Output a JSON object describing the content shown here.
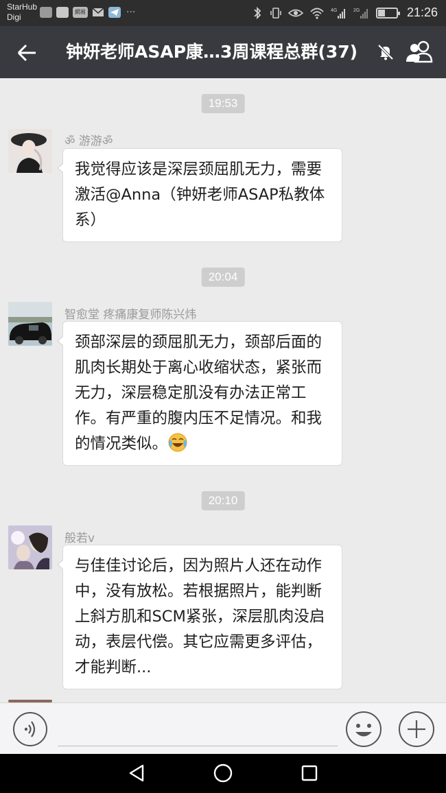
{
  "status_bar": {
    "carrier_line1": "StarHub",
    "carrier_line2": "Digi",
    "time": "21:26",
    "network_label": "網易",
    "signal_1_label": "4G",
    "signal_2_label": "2G",
    "battery_level": 0.4
  },
  "header": {
    "title": "钟妍老师ASAP康…3周课程总群(37)",
    "back_icon": "arrow-left-icon",
    "mute_icon": "bell-off-icon",
    "members_icon": "group-icon"
  },
  "chat": {
    "messages": [
      {
        "time": "19:53",
        "sender": "ॐ 游游ॐ",
        "text": "我觉得应该是深层颈屈肌无力，需要激活@Anna（钟妍老师ASAP私教体系）"
      },
      {
        "time": "20:04",
        "sender": "智愈堂 疼痛康复师陈兴炜",
        "text": "颈部深层的颈屈肌无力，颈部后面的肌肉长期处于离心收缩状态，紧张而无力，深层稳定肌没有办法正常工作。有严重的腹内压不足情况。和我的情况类似。",
        "emoji": "crying-laughing-emoji"
      },
      {
        "time": "20:10",
        "sender": "般若v",
        "text": "与佳佳讨论后，因为照片人还在动作中，没有放松。若根据照片，能判断上斜方肌和SCM紧张，深层肌肉没启动，表层代偿。其它应需更多评估，才能判断..."
      }
    ]
  },
  "input_bar": {
    "voice_icon": "voice-icon",
    "emoji_icon": "smiley-icon",
    "plus_icon": "plus-icon"
  },
  "nav_bar": {
    "back_icon": "triangle-back-icon",
    "home_icon": "circle-home-icon",
    "recent_icon": "square-recent-icon"
  }
}
